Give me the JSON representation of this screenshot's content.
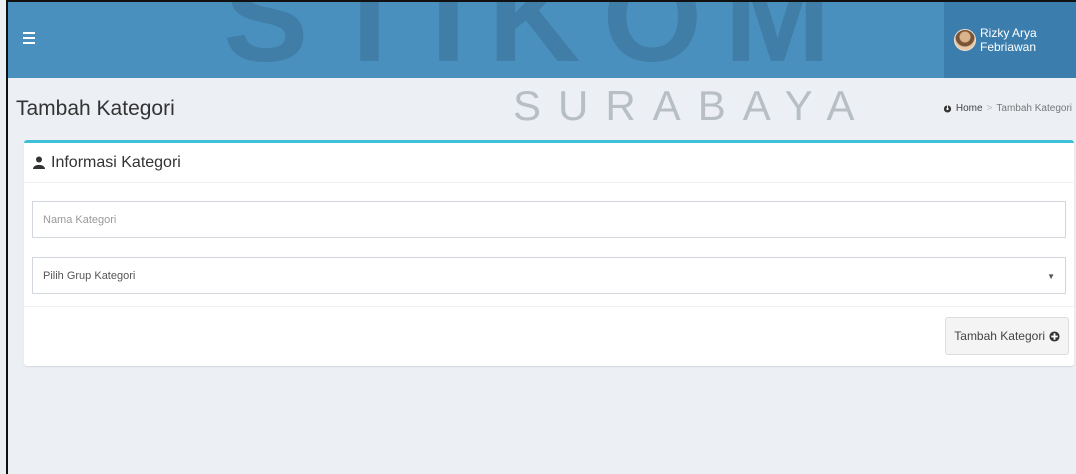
{
  "navbar": {
    "menu_icon": "hamburger-icon",
    "user_name": "Rizky Arya Febriawan",
    "background": "#4a90bf",
    "user_bg": "#3b7eae"
  },
  "watermark": {
    "top_text": "STIKOM",
    "bottom_text": "SURABAYA"
  },
  "content_header": {
    "title": "Tambah Kategori",
    "breadcrumb": {
      "home_icon": "dashboard-icon",
      "home_label": "Home",
      "separator": ">",
      "current": "Tambah Kategori"
    }
  },
  "box": {
    "accent": "#3fc0d8",
    "header_icon": "user-icon",
    "header_title": "Informasi Kategori",
    "name_input": {
      "placeholder": "Nama Kategori",
      "value": ""
    },
    "group_select": {
      "selected": "Pilih Grup Kategori"
    },
    "submit_button": {
      "label": "Tambah Kategori",
      "icon": "plus-circle-icon"
    }
  }
}
